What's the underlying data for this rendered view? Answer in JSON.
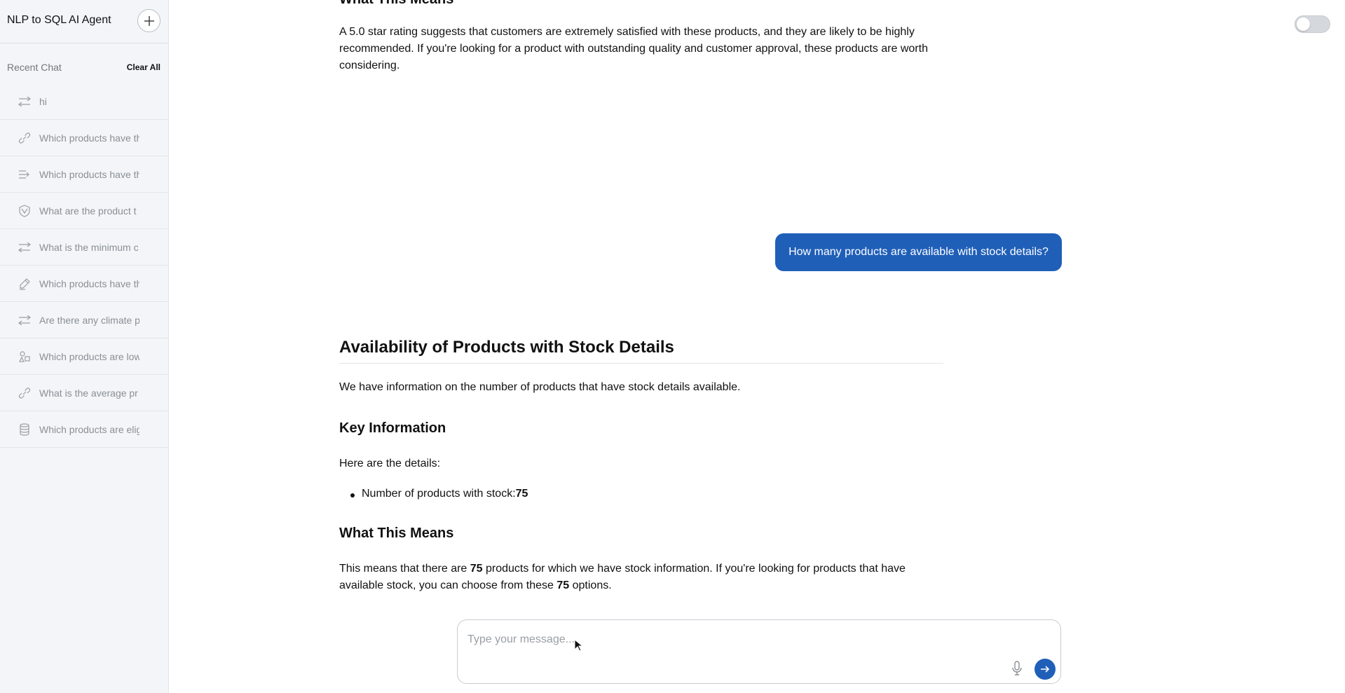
{
  "sidebar": {
    "app_title": "NLP to SQL AI Agent",
    "recent_label": "Recent Chat",
    "clear_all": "Clear All",
    "items": [
      {
        "icon": "swap-icon",
        "label": "hi"
      },
      {
        "icon": "link-icon",
        "label": "Which products have th"
      },
      {
        "icon": "list-arrow-icon",
        "label": "Which products have th"
      },
      {
        "icon": "shield-icon",
        "label": "What are the product t"
      },
      {
        "icon": "swap-icon",
        "label": "What is the minimum c"
      },
      {
        "icon": "pen-icon",
        "label": "Which products have th"
      },
      {
        "icon": "swap-icon",
        "label": "Are there any climate p"
      },
      {
        "icon": "shapes-icon",
        "label": "Which products are low"
      },
      {
        "icon": "link-icon",
        "label": "What is the average pr"
      },
      {
        "icon": "cylinder-icon",
        "label": "Which products are elig"
      }
    ]
  },
  "main": {
    "prev_heading": "What This Means",
    "prev_paragraph": "A 5.0 star rating suggests that customers are extremely satisfied with these products, and they are likely to be highly recommended. If you're looking for a product with outstanding quality and customer approval, these products are worth considering.",
    "user_message": "How many products are available with stock details?",
    "answer": {
      "title": "Availability of Products with Stock Details",
      "intro": "We have information on the number of products that have stock details available.",
      "key_heading": "Key Information",
      "details_intro": "Here are the details:",
      "bullet_label": "Number of products with stock: ",
      "bullet_value": "75",
      "means_heading": "What This Means",
      "means_part1": "This means that there are ",
      "means_num1": "75",
      "means_part2": " products for which we have stock information. If you're looking for products that have available stock, you can choose from these ",
      "means_num2": "75",
      "means_part3": " options."
    }
  },
  "input": {
    "placeholder": "Type your message..."
  },
  "colors": {
    "accent": "#1f5fb8",
    "sidebar_bg": "#f3f5f8"
  }
}
